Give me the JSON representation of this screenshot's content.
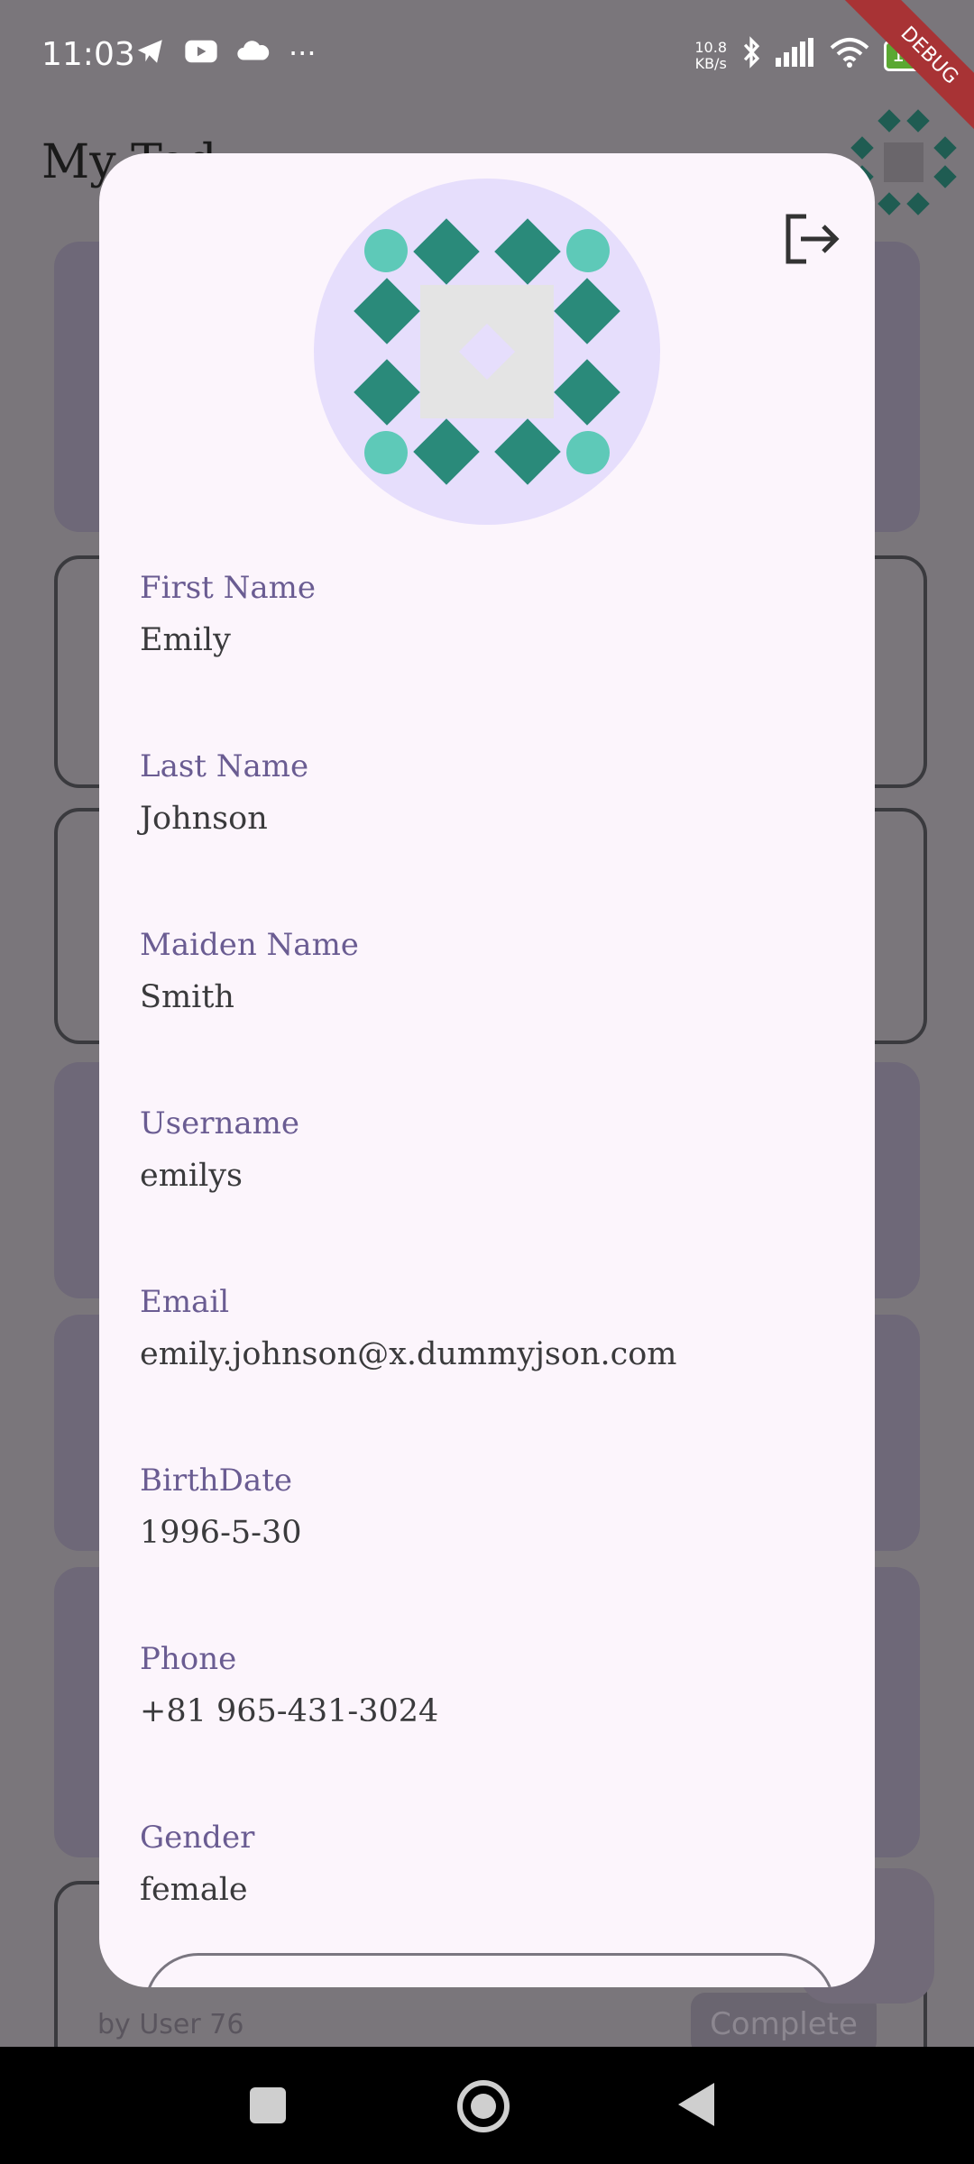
{
  "status_bar": {
    "time": "11:03",
    "left_icons": [
      "telegram-icon",
      "youtube-icon",
      "cloud-icon",
      "more-icon"
    ],
    "more": "···",
    "speed_value": "10.8",
    "speed_unit": "KB/s",
    "battery": "100",
    "debug_banner": "DEBUG"
  },
  "background": {
    "title": "My Tod",
    "byline": "by User 76",
    "complete_label": "Complete"
  },
  "profile": {
    "fields": [
      {
        "label": "First Name",
        "value": "Emily"
      },
      {
        "label": "Last Name",
        "value": "Johnson"
      },
      {
        "label": "Maiden Name",
        "value": "Smith"
      },
      {
        "label": "Username",
        "value": "emilys"
      },
      {
        "label": "Email",
        "value": "emily.johnson@x.dummyjson.com"
      },
      {
        "label": "BirthDate",
        "value": "1996-5-30"
      },
      {
        "label": "Phone",
        "value": "+81 965-431-3024"
      },
      {
        "label": "Gender",
        "value": "female"
      }
    ]
  },
  "colors": {
    "modal_bg": "#fcf5fc",
    "label": "#6a5c92",
    "avatar_bg": "#e6defc",
    "avatar_teal": "#2a8a7a",
    "avatar_mint": "#5ec9b8"
  }
}
